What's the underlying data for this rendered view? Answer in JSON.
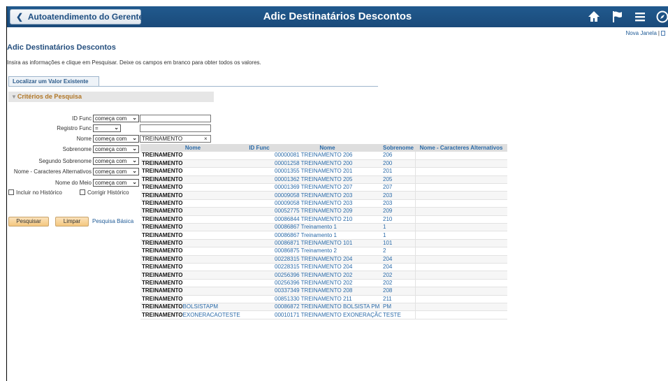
{
  "header": {
    "back_label": "Autoatendimento do Gerente",
    "title": "Adic Destinatários Descontos"
  },
  "nova_janela": "Nova Janela",
  "page_title": "Adic Destinatários Descontos",
  "instructions": "Insira as informações e clique em Pesquisar. Deixe os campos em branco para obter todos os valores.",
  "tab_label": "Localizar um Valor Existente",
  "criteria_label": "Critérios de Pesquisa",
  "fields": [
    {
      "label": "ID Func",
      "operator": "começa com",
      "value": ""
    },
    {
      "label": "Registro Func",
      "operator": "=",
      "value": ""
    },
    {
      "label": "Nome",
      "operator": "começa com",
      "value": "TREINAMENTO"
    },
    {
      "label": "Sobrenome",
      "operator": "começa com",
      "value": ""
    },
    {
      "label": "Segundo Sobrenome",
      "operator": "começa com",
      "value": ""
    },
    {
      "label": "Nome - Caracteres Alternativos",
      "operator": "começa com",
      "value": ""
    },
    {
      "label": "Nome do Meio",
      "operator": "começa com",
      "value": ""
    }
  ],
  "clear_symbol": "×",
  "checkboxes": {
    "history": "Incluir no Histórico",
    "correct": "Corrigir Histórico"
  },
  "buttons": {
    "search": "Pesquisar",
    "clear": "Limpar",
    "basic": "Pesquisa Básica"
  },
  "results": {
    "columns": [
      "Nome",
      "ID Func",
      "Nome",
      "Sobrenome",
      "Nome - Caracteres Alternativos"
    ],
    "rows": [
      [
        "TREINAMENTO",
        "",
        "00000081",
        "TREINAMENTO 206",
        "206",
        ""
      ],
      [
        "TREINAMENTO",
        "",
        "00001258",
        "TREINAMENTO 200",
        "200",
        ""
      ],
      [
        "TREINAMENTO",
        "",
        "00001355",
        "TREINAMENTO 201",
        "201",
        ""
      ],
      [
        "TREINAMENTO",
        "",
        "00001362",
        "TREINAMENTO 205",
        "205",
        ""
      ],
      [
        "TREINAMENTO",
        "",
        "00001369",
        "TREINAMENTO 207",
        "207",
        ""
      ],
      [
        "TREINAMENTO",
        "",
        "00009058",
        "TREINAMENTO 203",
        "203",
        ""
      ],
      [
        "TREINAMENTO",
        "",
        "00009058",
        "TREINAMENTO 203",
        "203",
        ""
      ],
      [
        "TREINAMENTO",
        "",
        "00052775",
        "TREINAMENTO 209",
        "209",
        ""
      ],
      [
        "TREINAMENTO",
        "",
        "00086844",
        "TREINAMENTO 210",
        "210",
        ""
      ],
      [
        "TREINAMENTO",
        "",
        "00086867",
        "Treinamento 1",
        "1",
        ""
      ],
      [
        "TREINAMENTO",
        "",
        "00086867",
        "Treinamento 1",
        "1",
        ""
      ],
      [
        "TREINAMENTO",
        "",
        "00086871",
        "TREINAMENTO 101",
        "101",
        ""
      ],
      [
        "TREINAMENTO",
        "",
        "00086875",
        "Treinamento 2",
        "2",
        ""
      ],
      [
        "TREINAMENTO",
        "",
        "00228315",
        "TREINAMENTO 204",
        "204",
        ""
      ],
      [
        "TREINAMENTO",
        "",
        "00228315",
        "TREINAMENTO 204",
        "204",
        ""
      ],
      [
        "TREINAMENTO",
        "",
        "00256396",
        "TREINAMENTO 202",
        "202",
        ""
      ],
      [
        "TREINAMENTO",
        "",
        "00256396",
        "TREINAMENTO 202",
        "202",
        ""
      ],
      [
        "TREINAMENTO",
        "",
        "00337349",
        "TREINAMENTO 208",
        "208",
        ""
      ],
      [
        "TREINAMENTO",
        "",
        "00851330",
        "TREINAMENTO 211",
        "211",
        ""
      ],
      [
        "TREINAMENTO",
        "BOLSISTAPM",
        "00086872",
        "TREINAMENTO BOLSISTA PM",
        "PM",
        ""
      ],
      [
        "TREINAMENTO",
        "EXONERACAOTESTE",
        "00010171",
        "TREINAMENTO EXONERAÇÃO TESTE",
        "TESTE",
        ""
      ]
    ]
  },
  "colors": {
    "topbar": "#215a8e",
    "link": "#2a6aa8",
    "criteria_text": "#b07626",
    "button": "#f4c77f"
  },
  "icons": [
    "chevron-left-icon",
    "home-icon",
    "flag-icon",
    "hamburger-menu-icon",
    "navbar-compass-icon"
  ]
}
